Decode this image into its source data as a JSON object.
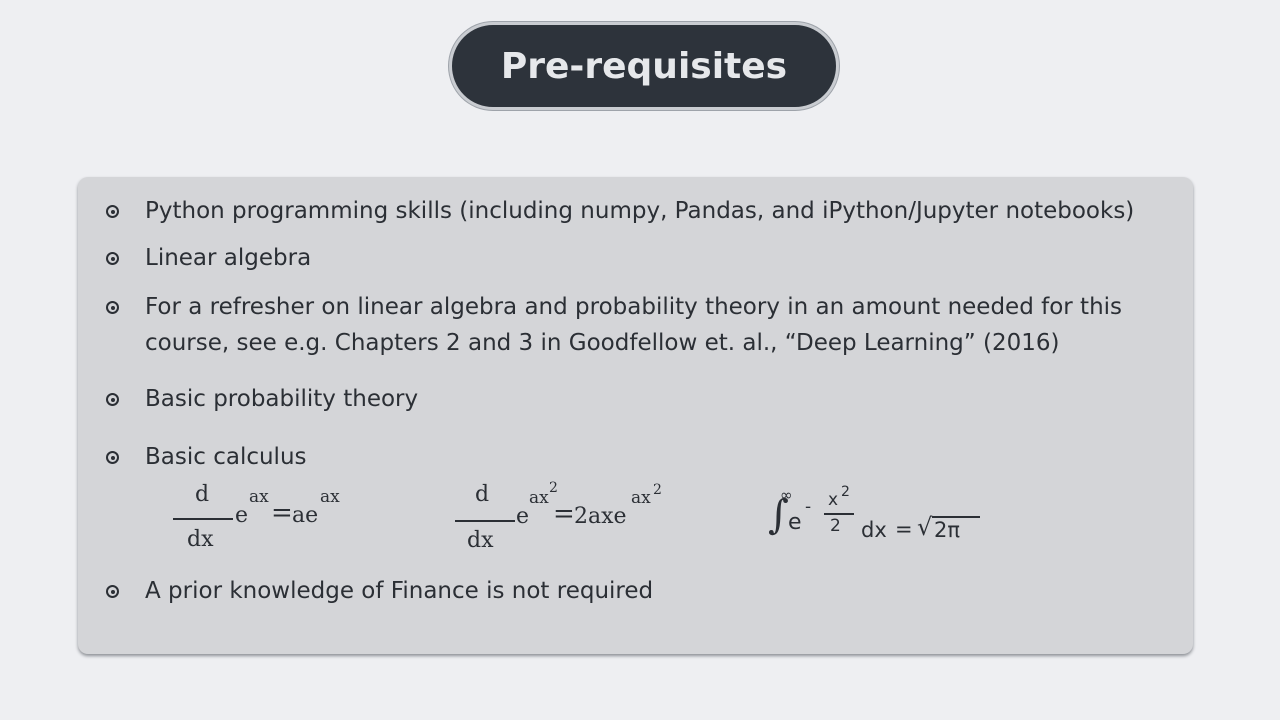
{
  "header": {
    "title": "Pre-requisites"
  },
  "bullets": [
    {
      "text": "Python programming skills (including numpy, Pandas, and iPython/Jupyter notebooks)"
    },
    {
      "text": "Linear algebra"
    },
    {
      "line1": "For a refresher on linear algebra and probability theory in an amount needed for this",
      "line2": "course, see e.g. Chapters 2 and 3 in Goodfellow et. al., “Deep Learning” (2016)"
    },
    {
      "text": "Basic probability theory"
    },
    {
      "text": "Basic calculus"
    },
    {
      "text": "A prior  knowledge of Finance is not required"
    }
  ],
  "formulas": {
    "f1": {
      "num": "d",
      "den": "dx",
      "base": "e",
      "exp": "ax",
      "eq": "=",
      "rhs_coef": "ae",
      "rhs_exp": "ax"
    },
    "f2": {
      "num": "d",
      "den": "dx",
      "base": "e",
      "exp": "ax",
      "exp_pow": "2",
      "eq": "=",
      "rhs_coef": "2axe",
      "rhs_exp": "ax",
      "rhs_exp_pow": "2"
    },
    "f3": {
      "integral": "∫",
      "upper": "∞",
      "base": "e",
      "minus": "-",
      "frac_num": "x",
      "frac_num_pow": "2",
      "frac_den": "2",
      "dx": "dx",
      "eq": "=",
      "sqrt": "√",
      "radicand": "2π"
    }
  }
}
